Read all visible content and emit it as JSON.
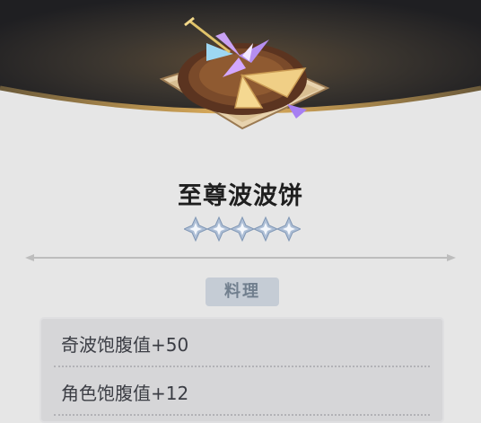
{
  "item": {
    "name": "至尊波波饼",
    "rarity_stars": 5,
    "category_tag": "料理",
    "effects": [
      "奇波饱腹值+50",
      "角色饱腹值+12"
    ]
  },
  "icons": {
    "dish": "dish-illustration-icon",
    "star": "diamond-star-icon"
  },
  "colors": {
    "banner_dark": "#2b2b30",
    "banner_rim": "#c9913c",
    "panel_bg": "#e6e6e6",
    "tag_bg": "#c5ccd5",
    "tag_text": "#717f8e",
    "stats_bg": "#d6d6d8",
    "title_text": "#1f1f1f"
  }
}
